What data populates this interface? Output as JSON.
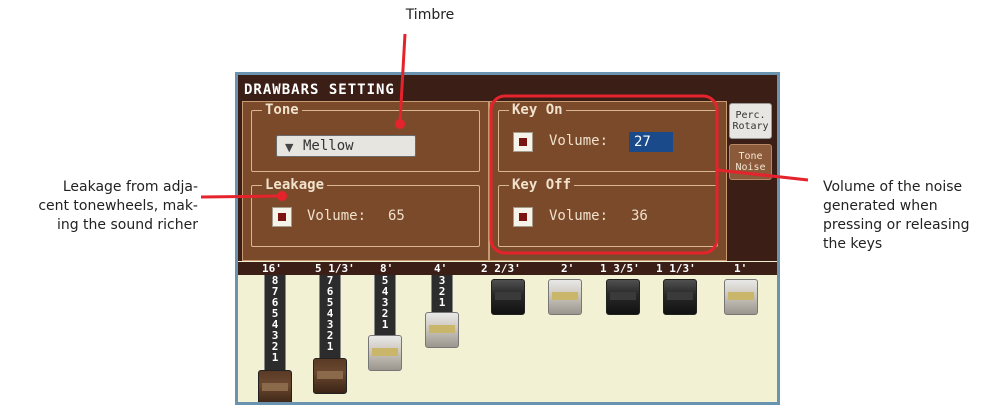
{
  "callouts": {
    "timbre": "Timbre",
    "leakage": [
      "Leakage from adja-",
      "cent tonewheels, mak-",
      "ing the sound richer"
    ],
    "noise": [
      "Volume of the noise",
      "generated when",
      "pressing or releasing",
      "the keys"
    ]
  },
  "screen": {
    "title": "DRAWBARS SETTING",
    "tone": {
      "legend": "Tone",
      "value": "Mellow"
    },
    "leakage": {
      "legend": "Leakage",
      "volume_label": "Volume:",
      "volume_value": "65",
      "enabled": true
    },
    "key_on": {
      "legend": "Key On",
      "volume_label": "Volume:",
      "volume_value": "27",
      "enabled": true
    },
    "key_off": {
      "legend": "Key Off",
      "volume_label": "Volume:",
      "volume_value": "36",
      "enabled": true
    },
    "tabs": [
      {
        "label_lines": [
          "Perc.",
          "Rotary"
        ],
        "selected": false
      },
      {
        "label_lines": [
          "Tone",
          "Noise"
        ],
        "selected": true
      }
    ],
    "footages": [
      "16'",
      "5 1/3'",
      "8'",
      "4'",
      "2 2/3'",
      "2'",
      "1 3/5'",
      "1 1/3'",
      "1'"
    ],
    "drawbars": [
      {
        "level": 8,
        "knob": "brown"
      },
      {
        "level": 7,
        "knob": "brown"
      },
      {
        "level": 5,
        "knob": "white"
      },
      {
        "level": 3,
        "knob": "white"
      },
      {
        "level": 0,
        "knob": "black"
      },
      {
        "level": 0,
        "knob": "white"
      },
      {
        "level": 0,
        "knob": "black"
      },
      {
        "level": 0,
        "knob": "black"
      },
      {
        "level": 0,
        "knob": "white"
      }
    ]
  },
  "colors": {
    "callout_line": "#e5232c",
    "key_highlight": "#e5232c",
    "panel": "#7b4a2a",
    "screen_bg": "#f3f1d4"
  }
}
